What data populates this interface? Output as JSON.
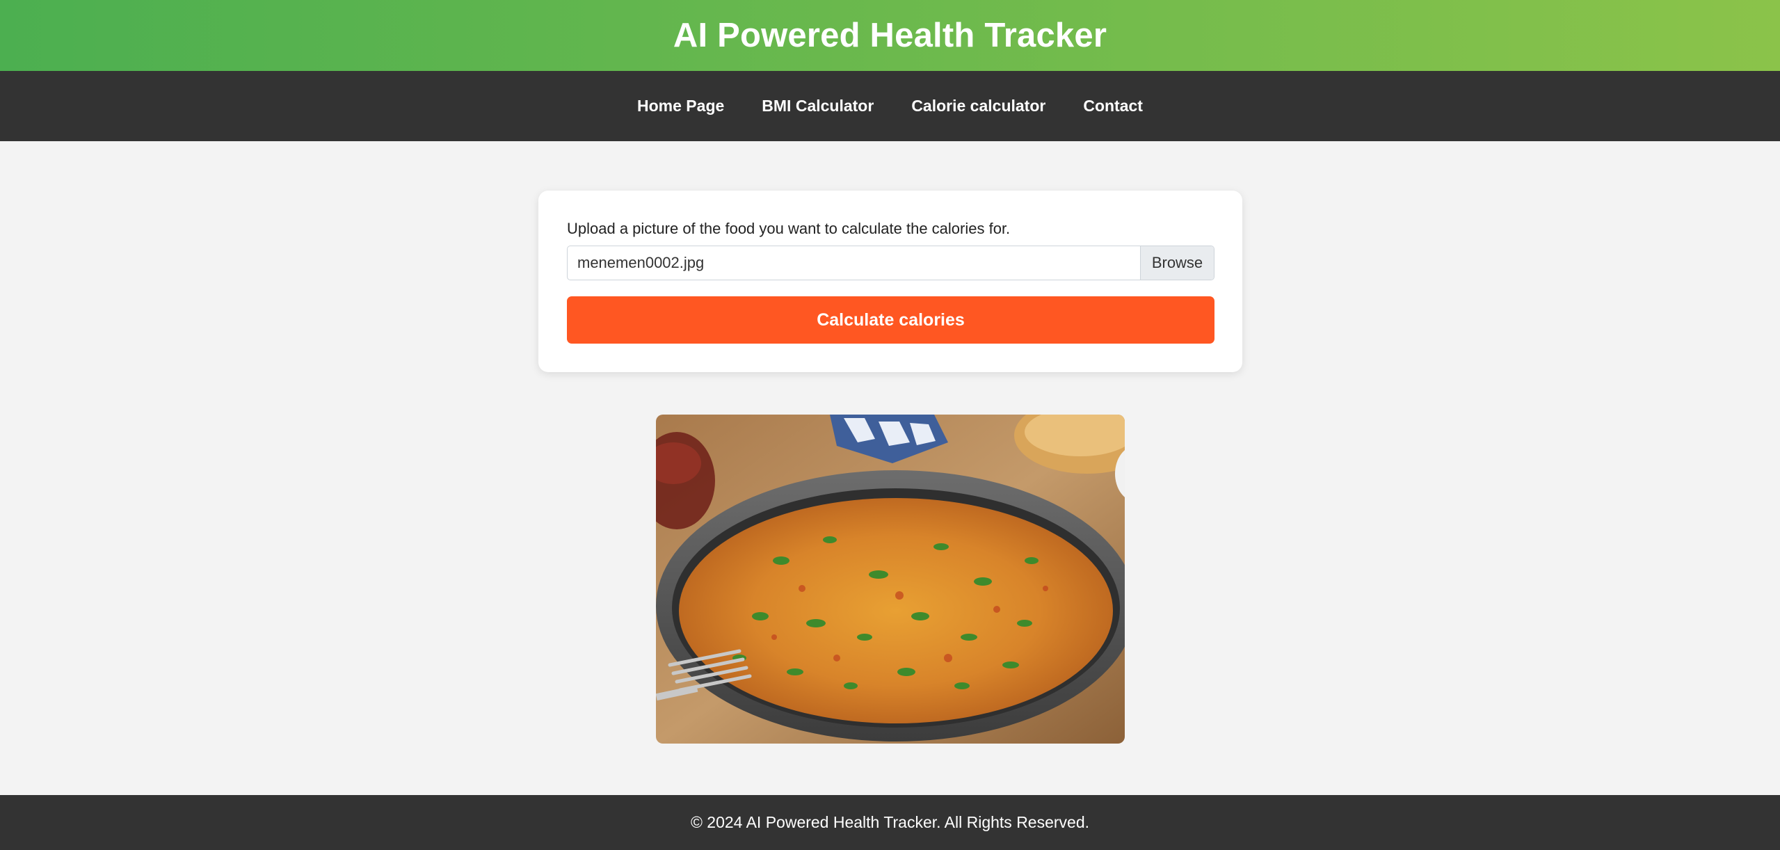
{
  "header": {
    "title": "AI Powered Health Tracker"
  },
  "nav": {
    "items": [
      {
        "label": "Home Page"
      },
      {
        "label": "BMI Calculator"
      },
      {
        "label": "Calorie calculator"
      },
      {
        "label": "Contact"
      }
    ]
  },
  "upload": {
    "label": "Upload a picture of the food you want to calculate the calories for.",
    "file_value": "menemen0002.jpg",
    "browse_label": "Browse",
    "submit_label": "Calculate calories"
  },
  "footer": {
    "text": "© 2024 AI Powered Health Tracker. All Rights Reserved."
  },
  "colors": {
    "header_gradient_start": "#4caf50",
    "header_gradient_end": "#8bc34a",
    "nav_background": "#333333",
    "accent_button": "#ff5722",
    "page_background": "#f3f3f3"
  }
}
